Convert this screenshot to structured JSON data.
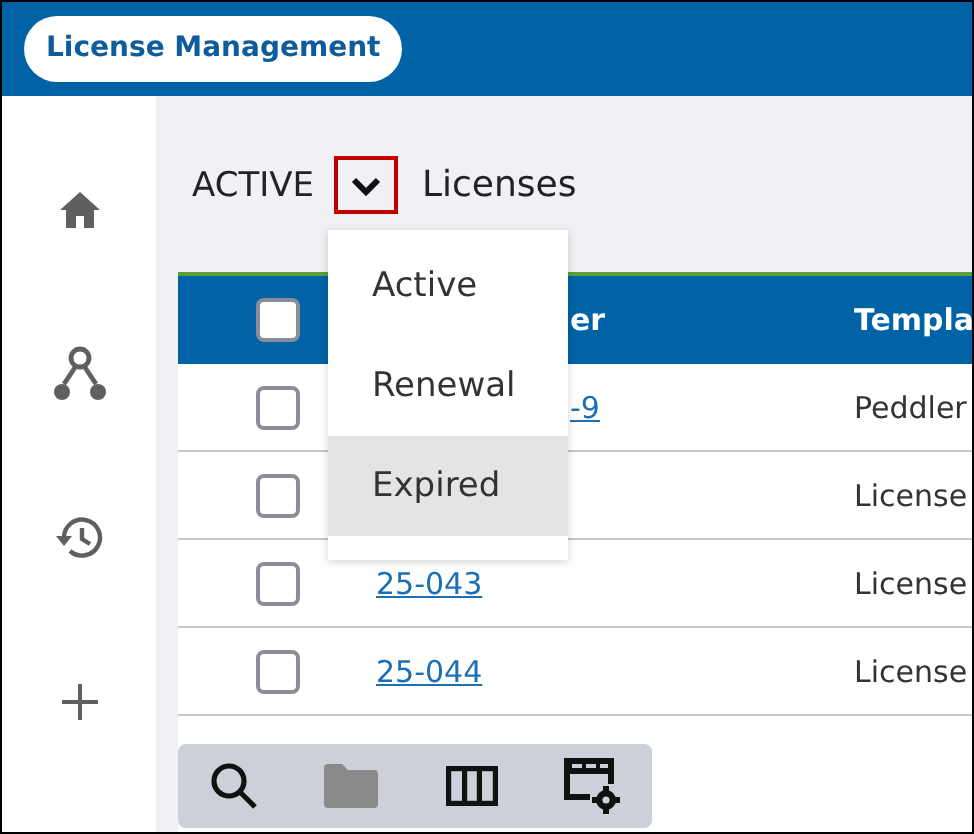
{
  "app_title": "License Management",
  "sidebar": {
    "items": [
      {
        "kind": "home"
      },
      {
        "kind": "workflow"
      },
      {
        "kind": "history"
      },
      {
        "kind": "add"
      }
    ]
  },
  "view": {
    "filter": "ACTIVE",
    "title": "Licenses"
  },
  "filter_menu": {
    "open": true,
    "options": [
      {
        "label": "Active",
        "highlighted": false
      },
      {
        "label": "Renewal",
        "highlighted": false
      },
      {
        "label": "Expired",
        "highlighted": true
      }
    ]
  },
  "table": {
    "select_all_checked": false,
    "columns": [
      {
        "label": "er"
      },
      {
        "label": "Templa"
      }
    ],
    "rows": [
      {
        "checked": false,
        "number": "-9",
        "template": "Peddler"
      },
      {
        "checked": false,
        "template": "License"
      },
      {
        "checked": false,
        "number": "25-043",
        "template": "License"
      },
      {
        "checked": false,
        "number": "25-044",
        "template": "License"
      }
    ]
  },
  "toolbar": [
    {
      "kind": "search",
      "disabled": false
    },
    {
      "kind": "folder",
      "disabled": true
    },
    {
      "kind": "columns",
      "disabled": false
    },
    {
      "kind": "table-settings",
      "disabled": false
    }
  ]
}
